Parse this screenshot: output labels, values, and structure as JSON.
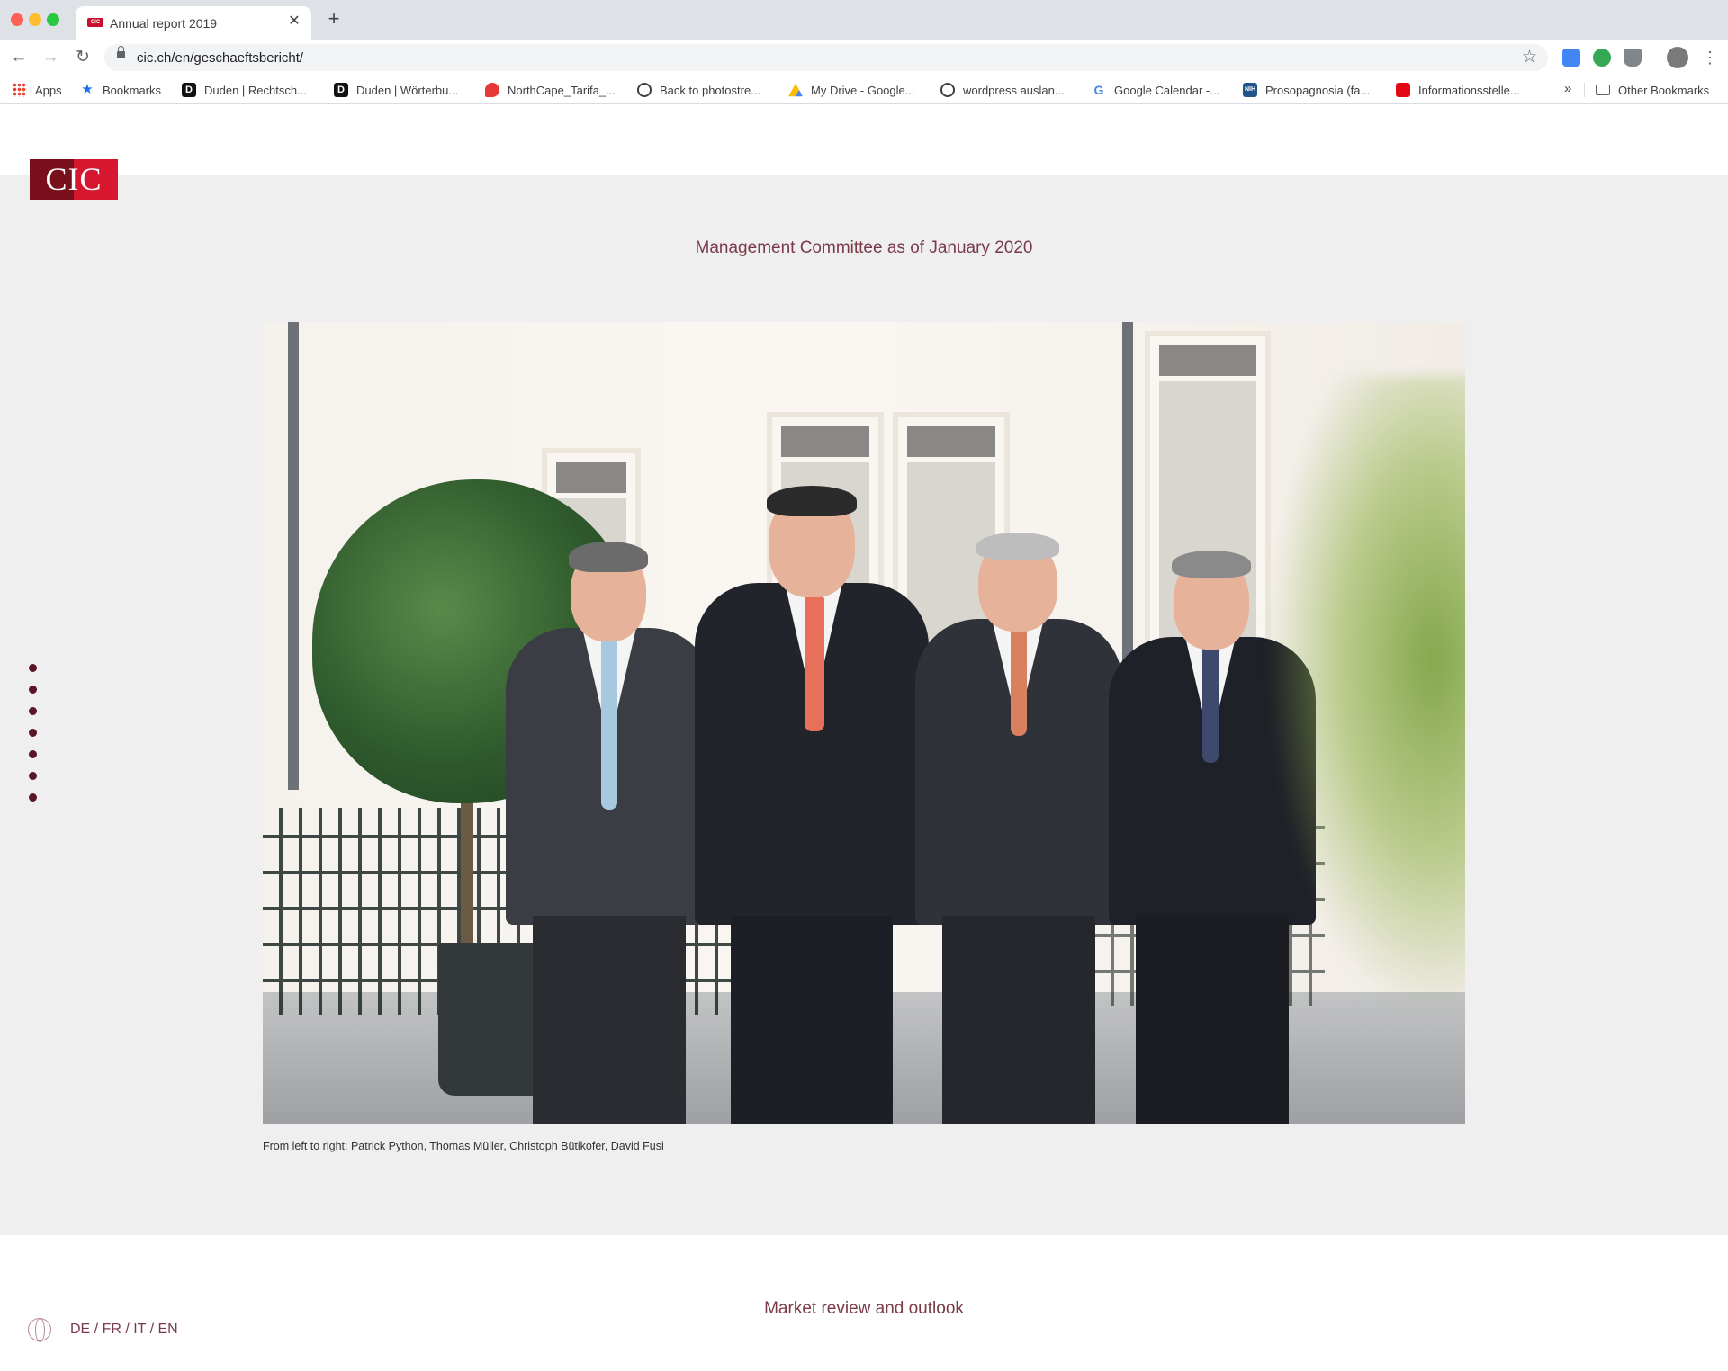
{
  "browser": {
    "tab_title": "Annual report 2019",
    "tab_close": "✕",
    "new_tab": "+",
    "url": "cic.ch/en/geschaeftsbericht/",
    "back": "←",
    "forward": "→",
    "reload": "↻",
    "star": "☆",
    "menu": "⋮",
    "bookmarks": [
      {
        "label": "Apps",
        "icon": "apps-icon"
      },
      {
        "label": "Bookmarks",
        "icon": "star-icon"
      },
      {
        "label": "Duden | Rechtsch...",
        "icon": "duden-icon"
      },
      {
        "label": "Duden | Wörterbu...",
        "icon": "duden-icon"
      },
      {
        "label": "NorthCape_Tarifa_...",
        "icon": "map-pin-icon"
      },
      {
        "label": "Back to photostre...",
        "icon": "globe-icon"
      },
      {
        "label": "My Drive - Google...",
        "icon": "google-drive-icon"
      },
      {
        "label": "wordpress auslan...",
        "icon": "globe-icon"
      },
      {
        "label": "Google Calendar -...",
        "icon": "google-icon"
      },
      {
        "label": "Prosopagnosia (fa...",
        "icon": "nih-icon"
      },
      {
        "label": "Informationsstelle...",
        "icon": "swiss-icon"
      }
    ],
    "bookmarks_more": "»",
    "other_bookmarks": "Other Bookmarks"
  },
  "page": {
    "logo_text": "CIC",
    "section_title": "Management Committee as of January 2020",
    "photo_caption": "From left to right: Patrick Python, Thomas Müller, Christoph Bütikofer, David Fusi",
    "next_section": "Market review and outlook",
    "language_switch": "DE / FR / IT / EN",
    "side_nav_count": 7
  },
  "colors": {
    "accent": "#7a3a49",
    "logo_red": "#d7172f",
    "logo_dark": "#7a0f1c",
    "background_grey": "#efefef"
  }
}
